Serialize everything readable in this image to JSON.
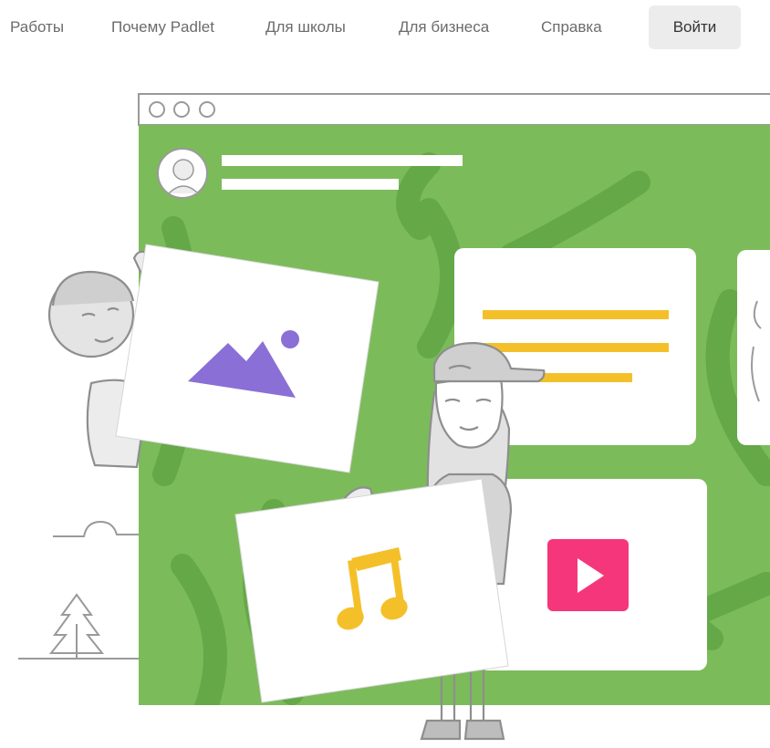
{
  "nav": {
    "items": [
      {
        "label": "Работы"
      },
      {
        "label": "Почему Padlet"
      },
      {
        "label": "Для школы"
      },
      {
        "label": "Для бизнеса"
      },
      {
        "label": "Справка"
      }
    ],
    "login_label": "Войти"
  },
  "colors": {
    "board_green": "#7cbb5a",
    "board_green_dark": "#5fa443",
    "mountain_purple": "#8a6fd6",
    "note_yellow": "#f4c02a",
    "video_pink": "#f5367a",
    "outline_gray": "#9a9a9a"
  },
  "icons": [
    "profile-avatar-icon",
    "image-mountain-icon",
    "music-note-icon",
    "video-play-icon",
    "tree-icon",
    "cloud-icon"
  ]
}
